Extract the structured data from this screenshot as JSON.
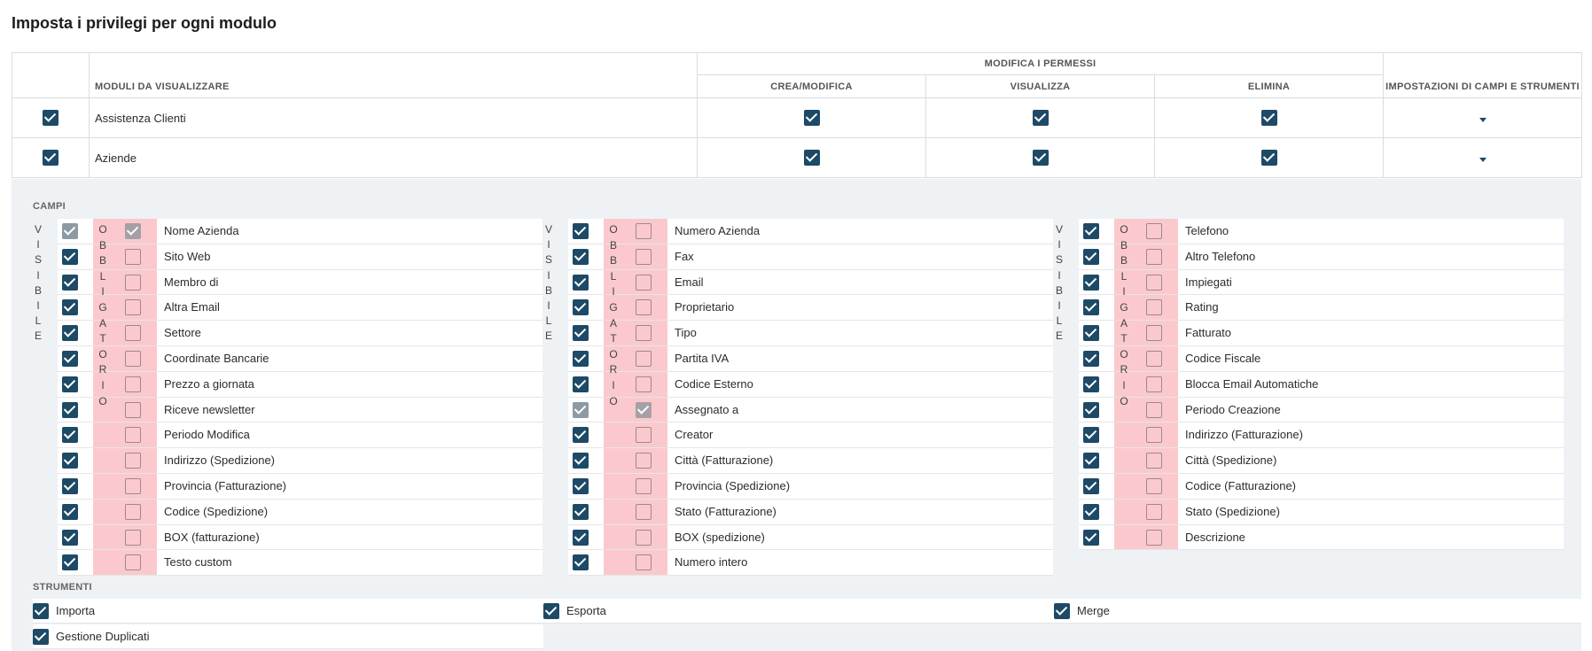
{
  "page": {
    "title": "Imposta i privilegi per ogni modulo"
  },
  "table": {
    "group_header": "MODIFICA I PERMESSI",
    "col_modules": "MODULI DA VISUALIZZARE",
    "col_create": "CREA/MODIFICA",
    "col_view": "VISUALIZZA",
    "col_delete": "ELIMINA",
    "col_settings": "IMPOSTAZIONI DI CAMPI E STRUMENTI",
    "rows": [
      {
        "name": "Assistenza Clienti",
        "enabled": true,
        "create": true,
        "view": true,
        "delete": true
      },
      {
        "name": "Aziende",
        "enabled": true,
        "create": true,
        "view": true,
        "delete": true
      }
    ]
  },
  "fields": {
    "label": "CAMPI",
    "visible_label": "VISIBILE",
    "required_label": "OBBLIGATORIO",
    "columns": [
      [
        {
          "name": "Nome Azienda",
          "visible": "locked",
          "required": "locked"
        },
        {
          "name": "Sito Web",
          "visible": true,
          "required": false
        },
        {
          "name": "Membro di",
          "visible": true,
          "required": false
        },
        {
          "name": "Altra Email",
          "visible": true,
          "required": false
        },
        {
          "name": "Settore",
          "visible": true,
          "required": false
        },
        {
          "name": "Coordinate Bancarie",
          "visible": true,
          "required": false
        },
        {
          "name": "Prezzo a giornata",
          "visible": true,
          "required": false
        },
        {
          "name": "Riceve newsletter",
          "visible": true,
          "required": false
        },
        {
          "name": "Periodo Modifica",
          "visible": true,
          "required": false
        },
        {
          "name": "Indirizzo (Spedizione)",
          "visible": true,
          "required": false
        },
        {
          "name": "Provincia (Fatturazione)",
          "visible": true,
          "required": false
        },
        {
          "name": "Codice (Spedizione)",
          "visible": true,
          "required": false
        },
        {
          "name": "BOX (fatturazione)",
          "visible": true,
          "required": false
        },
        {
          "name": "Testo custom",
          "visible": true,
          "required": false
        }
      ],
      [
        {
          "name": "Numero Azienda",
          "visible": true,
          "required": false
        },
        {
          "name": "Fax",
          "visible": true,
          "required": false
        },
        {
          "name": "Email",
          "visible": true,
          "required": false
        },
        {
          "name": "Proprietario",
          "visible": true,
          "required": false
        },
        {
          "name": "Tipo",
          "visible": true,
          "required": false
        },
        {
          "name": "Partita IVA",
          "visible": true,
          "required": false
        },
        {
          "name": "Codice Esterno",
          "visible": true,
          "required": false
        },
        {
          "name": "Assegnato a",
          "visible": "locked",
          "required": "locked"
        },
        {
          "name": "Creator",
          "visible": true,
          "required": false
        },
        {
          "name": "Città (Fatturazione)",
          "visible": true,
          "required": false
        },
        {
          "name": "Provincia (Spedizione)",
          "visible": true,
          "required": false
        },
        {
          "name": "Stato (Fatturazione)",
          "visible": true,
          "required": false
        },
        {
          "name": "BOX (spedizione)",
          "visible": true,
          "required": false
        },
        {
          "name": "Numero intero",
          "visible": true,
          "required": false
        }
      ],
      [
        {
          "name": "Telefono",
          "visible": true,
          "required": false
        },
        {
          "name": "Altro Telefono",
          "visible": true,
          "required": false
        },
        {
          "name": "Impiegati",
          "visible": true,
          "required": false
        },
        {
          "name": "Rating",
          "visible": true,
          "required": false
        },
        {
          "name": "Fatturato",
          "visible": true,
          "required": false
        },
        {
          "name": "Codice Fiscale",
          "visible": true,
          "required": false
        },
        {
          "name": "Blocca Email Automatiche",
          "visible": true,
          "required": false
        },
        {
          "name": "Periodo Creazione",
          "visible": true,
          "required": false
        },
        {
          "name": "Indirizzo (Fatturazione)",
          "visible": true,
          "required": false
        },
        {
          "name": "Città (Spedizione)",
          "visible": true,
          "required": false
        },
        {
          "name": "Codice (Fatturazione)",
          "visible": true,
          "required": false
        },
        {
          "name": "Stato (Spedizione)",
          "visible": true,
          "required": false
        },
        {
          "name": "Descrizione",
          "visible": true,
          "required": false
        }
      ]
    ]
  },
  "tools": {
    "label": "STRUMENTI",
    "items": [
      {
        "name": "Importa",
        "checked": true
      },
      {
        "name": "Esporta",
        "checked": true
      },
      {
        "name": "Merge",
        "checked": true
      },
      {
        "name": "Gestione Duplicati",
        "checked": true
      }
    ]
  },
  "colors": {
    "checkbox": "#1d4a66",
    "required_band": "#fbc9cd",
    "panel_bg": "#eef2f5"
  }
}
